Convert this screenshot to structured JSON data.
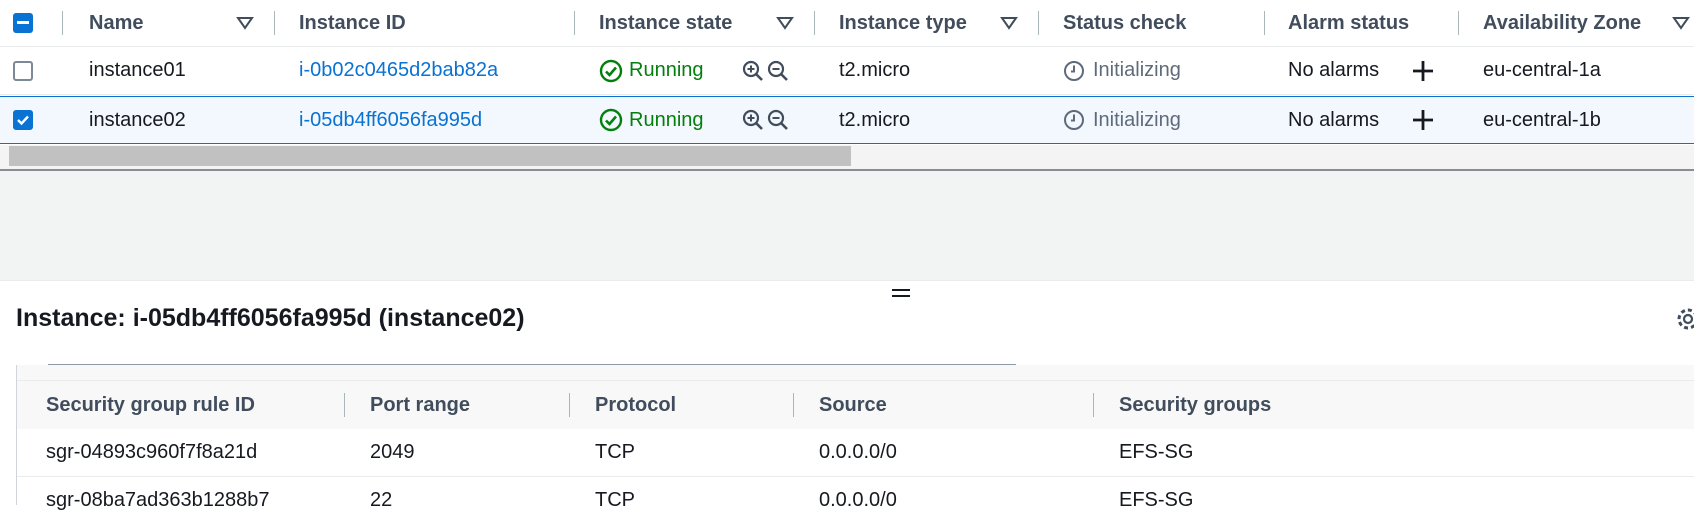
{
  "instances_table": {
    "columns": [
      "Name",
      "Instance ID",
      "Instance state",
      "Instance type",
      "Status check",
      "Alarm status",
      "Availability Zone"
    ],
    "rows": [
      {
        "name": "instance01",
        "instance_id": "i-0b02c0465d2bab82a",
        "state": "Running",
        "type": "t2.micro",
        "status_check": "Initializing",
        "alarm_status": "No alarms",
        "az": "eu-central-1a",
        "selected": false
      },
      {
        "name": "instance02",
        "instance_id": "i-05db4ff6056fa995d",
        "state": "Running",
        "type": "t2.micro",
        "status_check": "Initializing",
        "alarm_status": "No alarms",
        "az": "eu-central-1b",
        "selected": true
      }
    ]
  },
  "details": {
    "title": "Instance: i-05db4ff6056fa995d (instance02)"
  },
  "security_rules": {
    "columns": [
      "Security group rule ID",
      "Port range",
      "Protocol",
      "Source",
      "Security groups"
    ],
    "rows": [
      {
        "rule_id": "sgr-04893c960f7f8a21d",
        "port_range": "2049",
        "protocol": "TCP",
        "source": "0.0.0.0/0",
        "security_group": "EFS-SG"
      },
      {
        "rule_id": "sgr-08ba7ad363b1288b7",
        "port_range": "22",
        "protocol": "TCP",
        "source": "0.0.0.0/0",
        "security_group": "EFS-SG"
      }
    ]
  },
  "colors": {
    "link": "#0972d3",
    "running": "#037f0c",
    "selected_row": "#f2f8fd"
  },
  "icons": [
    "select-all-checkbox",
    "sort-triangle-icon",
    "check-circle-icon",
    "zoom-in-icon",
    "zoom-out-icon",
    "clock-icon",
    "plus-icon",
    "drag-handle-icon",
    "gear-icon"
  ]
}
